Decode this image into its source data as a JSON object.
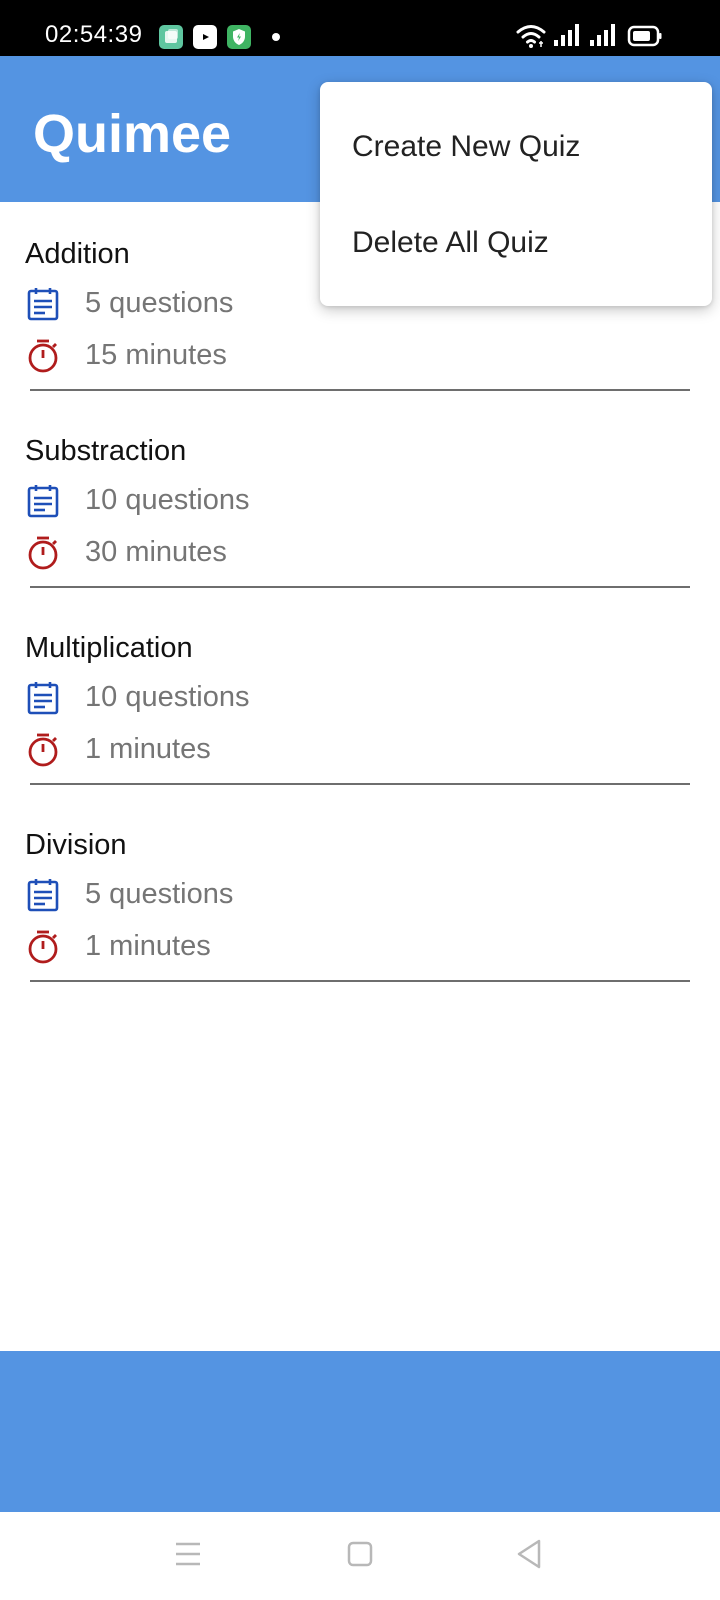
{
  "status_bar": {
    "time": "02:54:39",
    "icons": [
      "gallery-app-icon",
      "youtube-icon",
      "security-shield-icon",
      "notification-dot",
      "wifi-icon",
      "signal-icon",
      "signal-icon",
      "battery-icon"
    ]
  },
  "app_bar": {
    "title": "Quimee",
    "color": "#5494e2"
  },
  "quizzes": [
    {
      "name": "Addition",
      "questions": "5 questions",
      "duration": "15 minutes"
    },
    {
      "name": "Substraction",
      "questions": "10 questions",
      "duration": "30 minutes"
    },
    {
      "name": "Multiplication",
      "questions": "10 questions",
      "duration": "1 minutes"
    },
    {
      "name": "Division",
      "questions": "5 questions",
      "duration": "1 minutes"
    }
  ],
  "menu": {
    "items": [
      {
        "label": "Create New Quiz"
      },
      {
        "label": "Delete All Quiz"
      }
    ]
  },
  "colors": {
    "accent": "#5494e2",
    "question_icon": "#1e4fb8",
    "timer_icon": "#b01c1c"
  },
  "nav_bar": {
    "icons": [
      "menu-icon",
      "home-icon",
      "back-icon"
    ]
  }
}
